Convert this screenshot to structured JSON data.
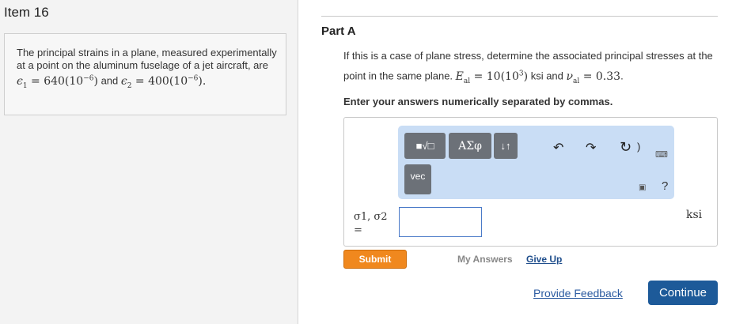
{
  "item": {
    "title": "Item 16"
  },
  "problem": {
    "text_a": "The principal strains in a plane, measured experimentally at a point on the aluminum fuselage of a jet aircraft, are ",
    "eps1": "ϵ",
    "eps1_sub": "1",
    "eq1": " = 640(10",
    "exp1": "−6",
    "close1": ")",
    "text_b": " and ",
    "eps2": "ϵ",
    "eps2_sub": "2",
    "eq2": " = 400(10",
    "exp2": "−6",
    "close2": ").",
    "text_c": ""
  },
  "part": {
    "title": "Part A",
    "question_a": "If this is a case of plane stress, determine the associated principal stresses at the point in the same plane. ",
    "E_sym": "E",
    "E_sub": "al",
    "E_val": " = 10(10",
    "E_exp": "3",
    "E_close": ")",
    "ksi_and": " ksi and ",
    "nu_sym": "ν",
    "nu_sub": "al",
    "nu_val": " = 0.33",
    "period": ".",
    "instruction": "Enter your answers numerically separated by commas."
  },
  "toolbar": {
    "templates_label": "■√□",
    "greek_label": "ΑΣφ",
    "arrows_label": "↓↑",
    "vec_label": "vec",
    "undo": "↶",
    "redo": "↷",
    "reset": "↻",
    "paren": ")",
    "keyboard": "⌨",
    "copy": "▣",
    "help": "?"
  },
  "answer": {
    "label_line1": "σ1, σ2",
    "label_line2": "=",
    "value": "",
    "unit": "ksi"
  },
  "actions": {
    "submit": "Submit",
    "my_answers": "My Answers",
    "give_up": "Give Up",
    "feedback": "Provide Feedback",
    "continue": "Continue"
  },
  "colors": {
    "submit": "#f0881e",
    "continue": "#1d5a99",
    "toolbar_bg": "#c9ddf5",
    "link": "#2a5aa0"
  }
}
